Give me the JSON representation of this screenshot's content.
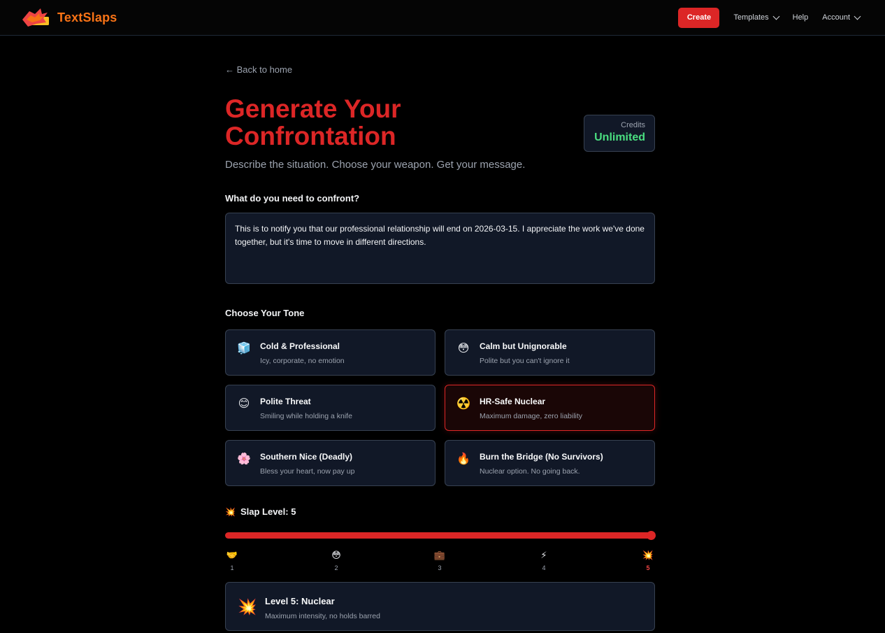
{
  "nav": {
    "brand": "TextSlaps",
    "create_label": "Create",
    "templates_label": "Templates",
    "help_label": "Help",
    "account_label": "Account"
  },
  "page": {
    "back_link": "← Back to home",
    "title": "Generate Your Confrontation",
    "subtitle": "Describe the situation. Choose your weapon. Get your message.",
    "credits_label": "Credits",
    "credits_value": "Unlimited"
  },
  "confront": {
    "label": "What do you need to confront?",
    "value": "This is to notify you that our professional relationship will end on 2026-03-15. I appreciate the work we've done together, but it's time to move in different directions."
  },
  "tone": {
    "label": "Choose Your Tone",
    "selected_index": 3,
    "options": [
      {
        "emoji": "🧊",
        "name": "Cold & Professional",
        "desc": "Icy, corporate, no emotion"
      },
      {
        "emoji": "😳",
        "name": "Calm but Unignorable",
        "desc": "Polite but you can't ignore it"
      },
      {
        "emoji": "😊",
        "name": "Polite Threat",
        "desc": "Smiling while holding a knife"
      },
      {
        "emoji": "☢️",
        "name": "HR-Safe Nuclear",
        "desc": "Maximum damage, zero liability"
      },
      {
        "emoji": "🌸",
        "name": "Southern Nice (Deadly)",
        "desc": "Bless your heart, now pay up"
      },
      {
        "emoji": "🔥",
        "name": "Burn the Bridge (No Survivors)",
        "desc": "Nuclear option. No going back."
      }
    ]
  },
  "slap": {
    "label": "Slap Level: 5",
    "value": 5,
    "min": 1,
    "max": 5,
    "marks": [
      {
        "emoji": "🤝",
        "num": "1"
      },
      {
        "emoji": "😳",
        "num": "2"
      },
      {
        "emoji": "💼",
        "num": "3"
      },
      {
        "emoji": "⚡",
        "num": "4"
      },
      {
        "emoji": "💥",
        "num": "5"
      }
    ],
    "level_name": "Level 5: Nuclear",
    "level_desc": "Maximum intensity, no holds barred",
    "level_emoji": "💥"
  },
  "colors": {
    "accent": "#dc2626",
    "brand": "#f97316",
    "credits": "#4ade80"
  }
}
